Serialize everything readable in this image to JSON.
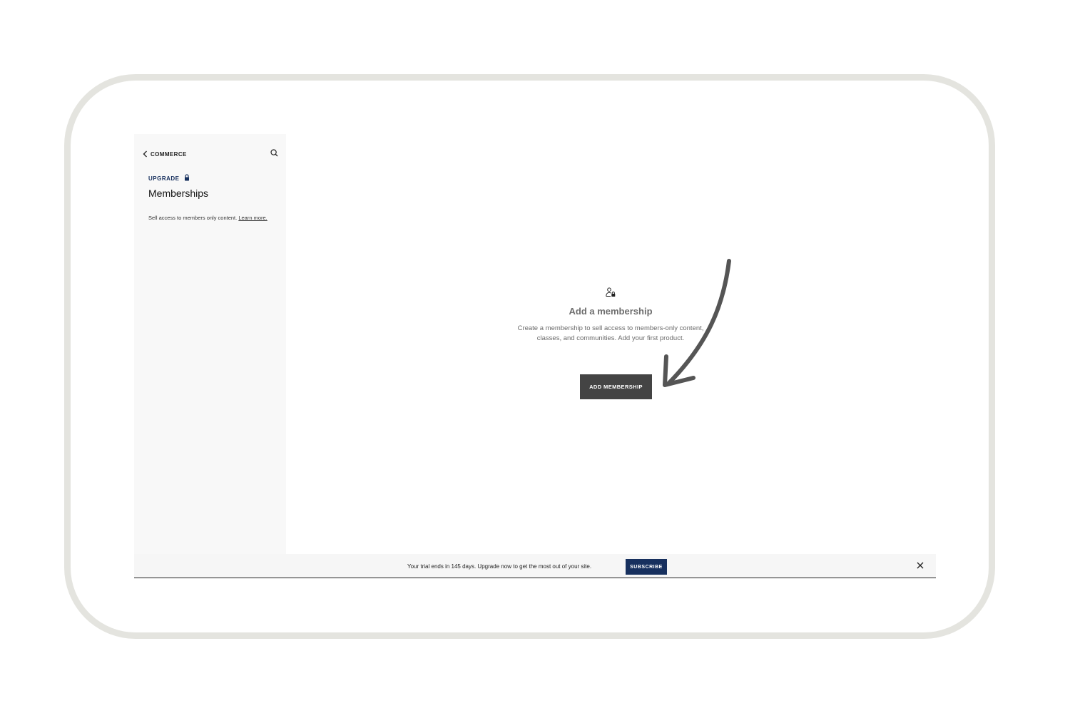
{
  "sidebar": {
    "back_label": "COMMERCE",
    "back_icon": "chevron-left-icon",
    "search_icon": "search-icon",
    "upgrade_label": "UPGRADE",
    "upgrade_icon": "lock-icon",
    "title": "Memberships",
    "description": "Sell access to members only content.",
    "learn_more": "Learn more."
  },
  "main": {
    "empty_icon": "member-lock-icon",
    "empty_title": "Add a membership",
    "empty_text": "Create a membership to sell access to members-only content, classes, and communities. Add your first product.",
    "add_button": "ADD MEMBERSHIP"
  },
  "trial_bar": {
    "message": "Your trial ends in 145 days. Upgrade now to get the most out of your site.",
    "subscribe_button": "SUBSCRIBE",
    "close_icon": "close-icon"
  },
  "colors": {
    "frame_border": "#e4e4df",
    "sidebar_bg": "#f8f8f8",
    "primary_button": "#444444",
    "subscribe_button": "#17305e",
    "annotation_arrow": "#555555"
  }
}
